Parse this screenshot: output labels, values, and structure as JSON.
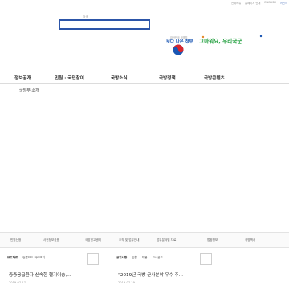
{
  "utility": {
    "links": [
      "전체메뉴",
      "홈페이지 안내",
      "ENGLISH",
      "어린이"
    ]
  },
  "search": {
    "label": "검색",
    "value": ""
  },
  "logo": {
    "small_text": "대한민국 국방부",
    "main_text": "보다 나은 정부",
    "slogan": "고마워요, 우리국군"
  },
  "gnb": {
    "items": [
      "정보공개",
      "민원 · 국민참여",
      "국방소식",
      "국방정책",
      "국방콘텐츠"
    ]
  },
  "main": {
    "section_title": "국방부 소개"
  },
  "quick_links": [
    "민원신청",
    "사전정보공표",
    "국방신고센터",
    "조직 및 업무안내",
    "업무분야별 자료",
    "법령정보",
    "국방백서"
  ],
  "news_left": {
    "tabs": [
      "보도자료",
      "언론보도 바로보기"
    ],
    "headline": "중증응급환자 신속한 헬기이송,...",
    "date": "2019-07-17"
  },
  "news_right": {
    "tabs": [
      "공지사항",
      "입찰",
      "채용",
      "고시공고"
    ],
    "headline": "“2019년 국방·군사분야 우수 주...",
    "date": "2019-07-19"
  },
  "colors": {
    "search_border": "#2c55a8",
    "slogan_green": "#1f9e3c",
    "slogan_blue": "#1a56b3"
  }
}
